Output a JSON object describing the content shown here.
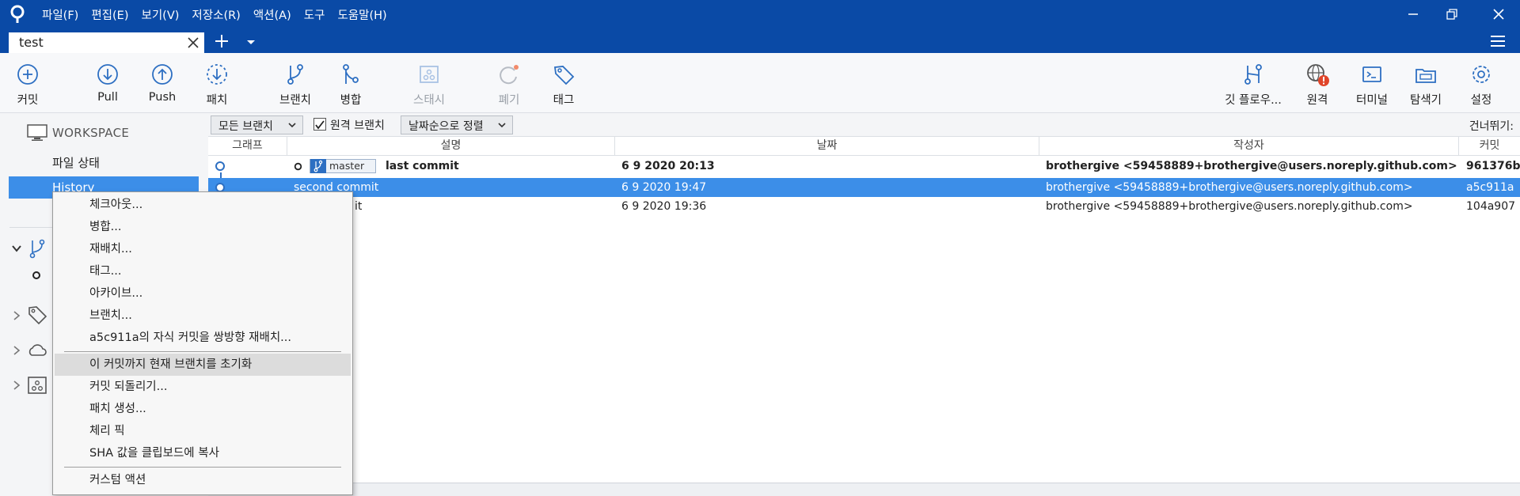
{
  "menubar": [
    "파일(F)",
    "편집(E)",
    "보기(V)",
    "저장소(R)",
    "액션(A)",
    "도구",
    "도움말(H)"
  ],
  "tab": {
    "label": "test"
  },
  "toolbar": {
    "commit": "커밋",
    "pull": "Pull",
    "push": "Push",
    "patch": "패치",
    "branch": "브랜치",
    "merge": "병합",
    "stash": "스태시",
    "discard": "폐기",
    "tag": "태그",
    "gitflow": "깃 플로우...",
    "remote": "원격",
    "terminal": "터미널",
    "explorer": "탐색기",
    "settings": "설정"
  },
  "sidebar": {
    "workspace": "WORKSPACE",
    "file_status": "파일 상태",
    "history": "History"
  },
  "filterbar": {
    "branches": "모든 브랜치",
    "remote_branches": "원격 브랜치",
    "sort": "날짜순으로 정렬",
    "skip": "건너뛰기:"
  },
  "table": {
    "headers": {
      "graph": "그래프",
      "desc": "설명",
      "date": "날짜",
      "author": "작성자",
      "commit": "커밋"
    },
    "rows": [
      {
        "branch": "master",
        "desc": "last commit",
        "date": "6 9 2020 20:13",
        "author": "brothergive <59458889+brothergive@users.noreply.github.com>",
        "commit": "961376b"
      },
      {
        "desc": "second commit",
        "date": "6 9 2020 19:47",
        "author": "brothergive <59458889+brothergive@users.noreply.github.com>",
        "commit": "a5c911a"
      },
      {
        "desc": "it",
        "date": "6 9 2020 19:36",
        "author": "brothergive <59458889+brothergive@users.noreply.github.com>",
        "commit": "104a907"
      }
    ]
  },
  "context_menu": {
    "items": [
      "체크아웃...",
      "병합...",
      "재배치...",
      "태그...",
      "아카이브...",
      "브랜치...",
      "a5c911a의 자식 커밋을 쌍방향 재배치...",
      "이 커밋까지 현재 브랜치를 초기화",
      "커밋 되돌리기...",
      "패치 생성...",
      "체리 픽",
      "SHA 값을 클립보드에 복사",
      "커스텀 액션"
    ]
  },
  "colors": {
    "titlebar": "#0a4aa6",
    "selection": "#3c8ee8",
    "accent": "#2d6fc2"
  }
}
